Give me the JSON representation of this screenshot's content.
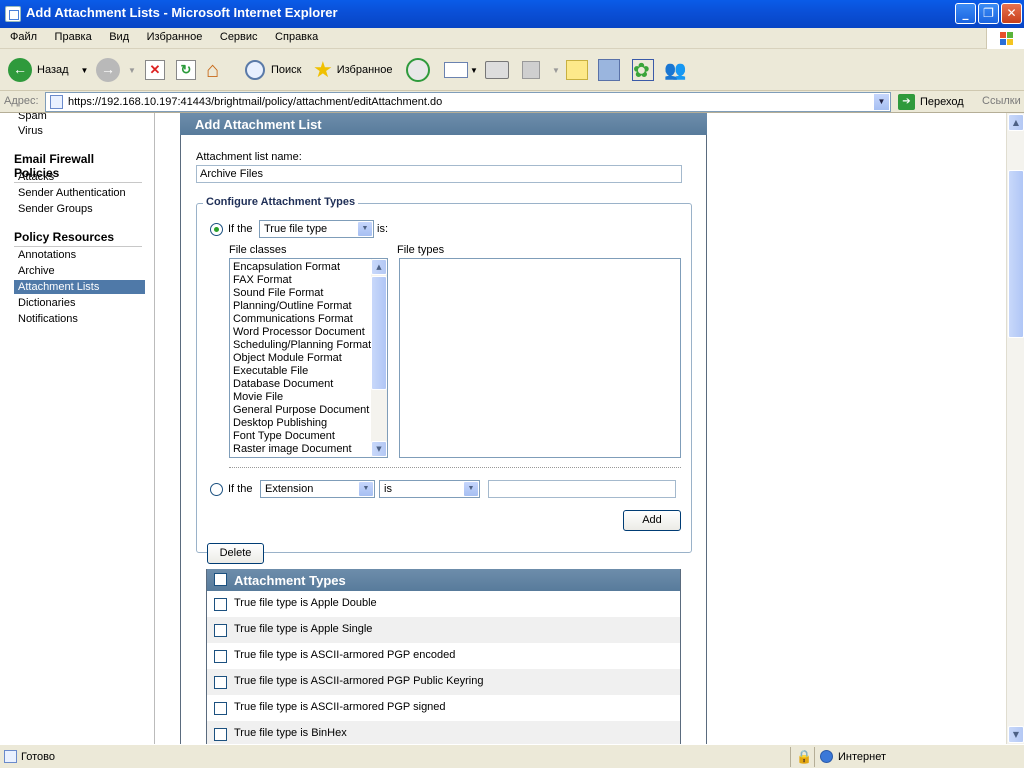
{
  "window": {
    "title": "Add Attachment Lists - Microsoft Internet Explorer"
  },
  "menu": [
    "Файл",
    "Правка",
    "Вид",
    "Избранное",
    "Сервис",
    "Справка"
  ],
  "toolbar": {
    "back": "Назад",
    "search": "Поиск",
    "favorites": "Избранное"
  },
  "address": {
    "label": "Адрес:",
    "url": "https://192.168.10.197:41443/brightmail/policy/attachment/editAttachment.do",
    "go": "Переход",
    "links": "Ссылки"
  },
  "sidebar": {
    "top_items": [
      "Spam",
      "Virus"
    ],
    "sections": [
      {
        "title": "Email Firewall Policies",
        "items": [
          "Attacks",
          "Sender Authentication",
          "Sender Groups"
        ]
      },
      {
        "title": "Policy Resources",
        "items": [
          "Annotations",
          "Archive",
          "Attachment Lists",
          "Dictionaries",
          "Notifications"
        ]
      }
    ],
    "active": "Attachment Lists"
  },
  "form": {
    "panel_title": "Add Attachment List",
    "name_label": "Attachment list name:",
    "name_value": "Archive Files",
    "configure_legend": "Configure Attachment Types",
    "if_the": "If the",
    "is_label": "is:",
    "type_select": "True file type",
    "file_classes_label": "File classes",
    "file_types_label": "File types",
    "file_classes": [
      "Encapsulation Format",
      "FAX Format",
      "Sound File Format",
      "Planning/Outline Format",
      "Communications Format",
      "Word Processor Document",
      "Scheduling/Planning Format",
      "Object Module Format",
      "Executable File",
      "Database Document",
      "Movie File",
      "General Purpose Document",
      "Desktop Publishing",
      "Font Type Document",
      "Raster image Document"
    ],
    "if_the_2": "If the",
    "extension_select": "Extension",
    "operator_select": "is",
    "extension_value": "",
    "add_button": "Add",
    "delete_button": "Delete"
  },
  "attachment_table": {
    "header": "Attachment Types",
    "rows": [
      "True file type is Apple Double",
      "True file type is Apple Single",
      "True file type is ASCII-armored PGP encoded",
      "True file type is ASCII-armored PGP Public Keyring",
      "True file type is ASCII-armored PGP signed",
      "True file type is BinHex"
    ]
  },
  "status": {
    "left": "Готово",
    "zone": "Интернет"
  }
}
